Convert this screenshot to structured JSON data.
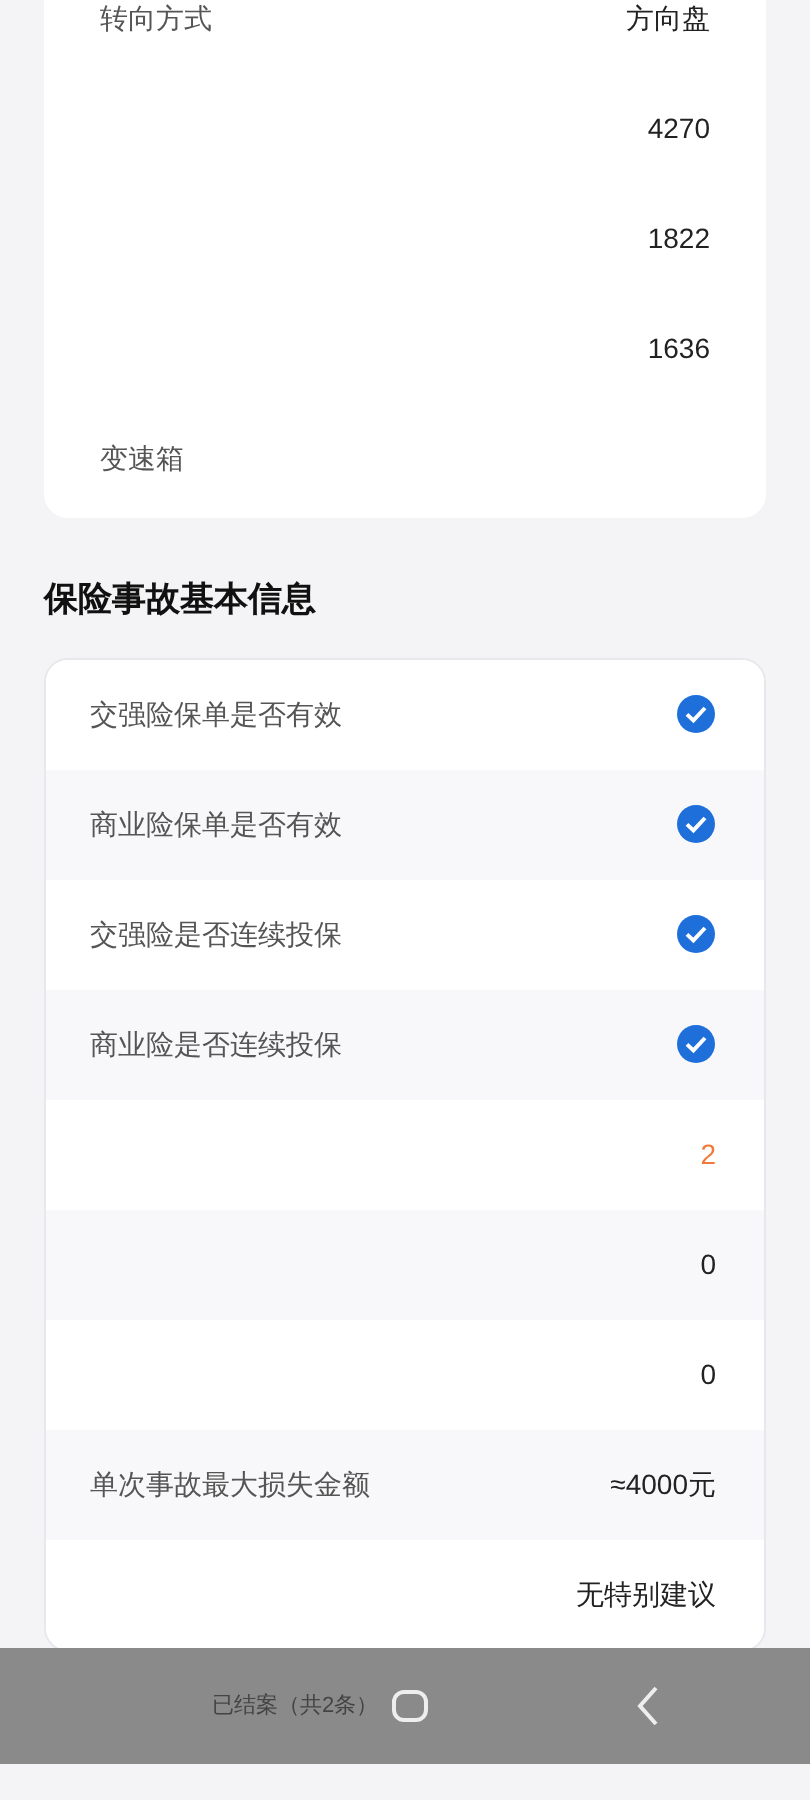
{
  "vehicle_rows": [
    {
      "label": "转向方式",
      "value": "方向盘"
    },
    {
      "value": "4270"
    },
    {
      "value": "1822"
    },
    {
      "value": "1636"
    },
    {
      "label": "变速箱"
    }
  ],
  "accident_section": {
    "title": "保险事故基本信息",
    "rows": [
      {
        "kind": "check",
        "label": "交强险保单是否有效",
        "checked": true
      },
      {
        "kind": "check",
        "label": "商业险保单是否有效",
        "checked": true
      },
      {
        "kind": "check",
        "label": "交强险是否连续投保",
        "checked": true
      },
      {
        "kind": "check",
        "label": "商业险是否连续投保",
        "checked": true
      },
      {
        "kind": "value",
        "value": "2",
        "emphasis": true
      },
      {
        "kind": "value",
        "value": "0",
        "emphasis": false
      },
      {
        "kind": "value",
        "value": "0",
        "emphasis": false
      },
      {
        "kind": "value",
        "label": "单次事故最大损失金额",
        "value": "≈4000元",
        "emphasis": false
      },
      {
        "kind": "value",
        "value": "无特别建议",
        "emphasis": false
      }
    ]
  },
  "bottom_bar": {
    "text": "已结案（共2条）"
  }
}
